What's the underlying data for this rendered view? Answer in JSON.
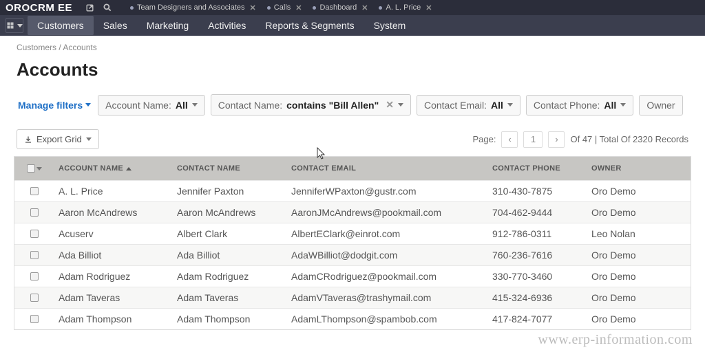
{
  "app": {
    "logo": "OROCRM EE"
  },
  "top_tabs": [
    {
      "label": "Team Designers and Associates"
    },
    {
      "label": "Calls"
    },
    {
      "label": "Dashboard"
    },
    {
      "label": "A. L. Price"
    }
  ],
  "menu": {
    "items": [
      "Customers",
      "Sales",
      "Marketing",
      "Activities",
      "Reports & Segments",
      "System"
    ],
    "active_index": 0
  },
  "breadcrumb": "Customers / Accounts",
  "page_title": "Accounts",
  "filters": {
    "manage_label": "Manage filters",
    "chips": [
      {
        "label": "Account Name:",
        "value": "All",
        "closable": false
      },
      {
        "label": "Contact Name:",
        "value": "contains \"Bill Allen\"",
        "closable": true
      },
      {
        "label": "Contact Email:",
        "value": "All",
        "closable": false
      },
      {
        "label": "Contact Phone:",
        "value": "All",
        "closable": false
      },
      {
        "label": "Owner",
        "value": "",
        "closable": false
      }
    ]
  },
  "toolbar": {
    "export_label": "Export Grid",
    "page_label": "Page:",
    "page_number": "1",
    "total_text": "Of 47 | Total Of 2320 Records"
  },
  "grid": {
    "headers": {
      "account": "ACCOUNT NAME",
      "contact_name": "CONTACT NAME",
      "contact_email": "CONTACT EMAIL",
      "contact_phone": "CONTACT PHONE",
      "owner": "OWNER"
    },
    "rows": [
      {
        "account": "A. L. Price",
        "cname": "Jennifer Paxton",
        "email": "JenniferWPaxton@gustr.com",
        "phone": "310-430-7875",
        "owner": "Oro Demo"
      },
      {
        "account": "Aaron McAndrews",
        "cname": "Aaron McAndrews",
        "email": "AaronJMcAndrews@pookmail.com",
        "phone": "704-462-9444",
        "owner": "Oro Demo"
      },
      {
        "account": "Acuserv",
        "cname": "Albert Clark",
        "email": "AlbertEClark@einrot.com",
        "phone": "912-786-0311",
        "owner": "Leo Nolan"
      },
      {
        "account": "Ada Billiot",
        "cname": "Ada Billiot",
        "email": "AdaWBilliot@dodgit.com",
        "phone": "760-236-7616",
        "owner": "Oro Demo"
      },
      {
        "account": "Adam Rodriguez",
        "cname": "Adam Rodriguez",
        "email": "AdamCRodriguez@pookmail.com",
        "phone": "330-770-3460",
        "owner": "Oro Demo"
      },
      {
        "account": "Adam Taveras",
        "cname": "Adam Taveras",
        "email": "AdamVTaveras@trashymail.com",
        "phone": "415-324-6936",
        "owner": "Oro Demo"
      },
      {
        "account": "Adam Thompson",
        "cname": "Adam Thompson",
        "email": "AdamLThompson@spambob.com",
        "phone": "417-824-7077",
        "owner": "Oro Demo"
      }
    ]
  },
  "watermark": "www.erp-information.com"
}
